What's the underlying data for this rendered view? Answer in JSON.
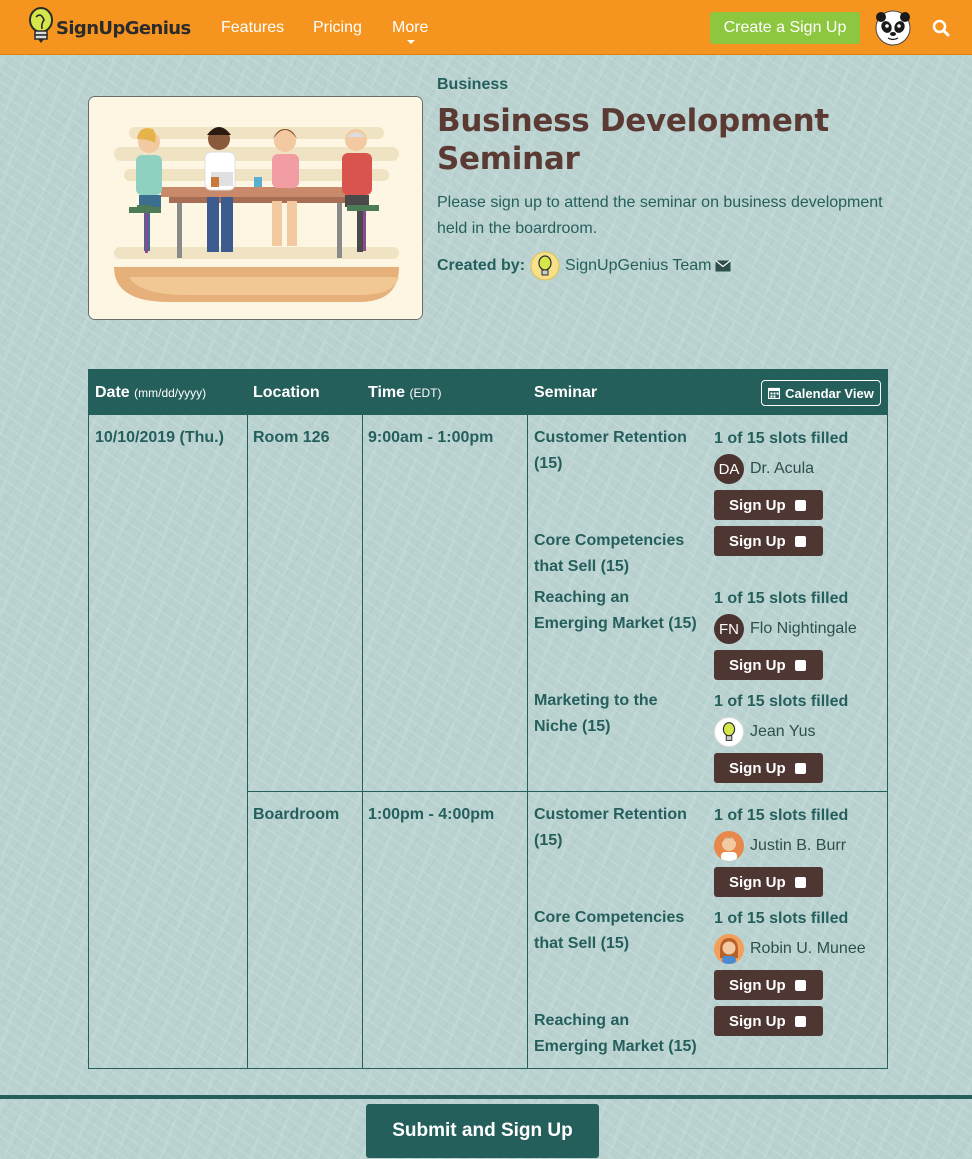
{
  "nav": {
    "logo_text": "SignUpGenius",
    "features": "Features",
    "pricing": "Pricing",
    "more": "More",
    "create_button": "Create a Sign Up"
  },
  "header": {
    "category": "Business",
    "title": "Business Development Seminar",
    "description": "Please sign up to attend the seminar on business development held in the boardroom.",
    "created_by_label": "Created by:",
    "creator": "SignUpGenius Team"
  },
  "table": {
    "headers": {
      "date": "Date",
      "date_format": "(mm/dd/yyyy)",
      "location": "Location",
      "time": "Time",
      "time_zone": "(EDT)",
      "seminar": "Seminar",
      "calendar_view": "Calendar View"
    },
    "date": "10/10/2019 (Thu.)",
    "groups": [
      {
        "location": "Room 126",
        "time": "9:00am - 1:00pm",
        "slots": [
          {
            "name": "Customer Retention (15)",
            "filled": "1 of 15 slots filled",
            "initials": "DA",
            "person": "Dr. Acula",
            "button": "Sign Up"
          },
          {
            "name": "Core Competencies that Sell (15)",
            "button": "Sign Up"
          },
          {
            "name": "Reaching an Emerging Market (15)",
            "filled": "1 of 15 slots filled",
            "initials": "FN",
            "person": "Flo Nightingale",
            "button": "Sign Up"
          },
          {
            "name": "Marketing to the Niche (15)",
            "filled": "1 of 15 slots filled",
            "person": "Jean Yus",
            "button": "Sign Up"
          }
        ]
      },
      {
        "location": "Boardroom",
        "time": "1:00pm - 4:00pm",
        "slots": [
          {
            "name": "Customer Retention (15)",
            "filled": "1 of 15 slots filled",
            "person": "Justin B. Burr",
            "button": "Sign Up"
          },
          {
            "name": "Core Competencies that Sell (15)",
            "filled": "1 of 15 slots filled",
            "person": "Robin U. Munee",
            "button": "Sign Up"
          },
          {
            "name": "Reaching an Emerging Market (15)",
            "button": "Sign Up"
          }
        ]
      }
    ]
  },
  "footer": {
    "submit": "Submit and Sign Up"
  },
  "colors": {
    "nav_orange": "#f5951f",
    "create_green": "#8dc63f",
    "table_teal": "#255f5b",
    "title_brown": "#5b3a33",
    "button_brown": "#4e3632"
  }
}
